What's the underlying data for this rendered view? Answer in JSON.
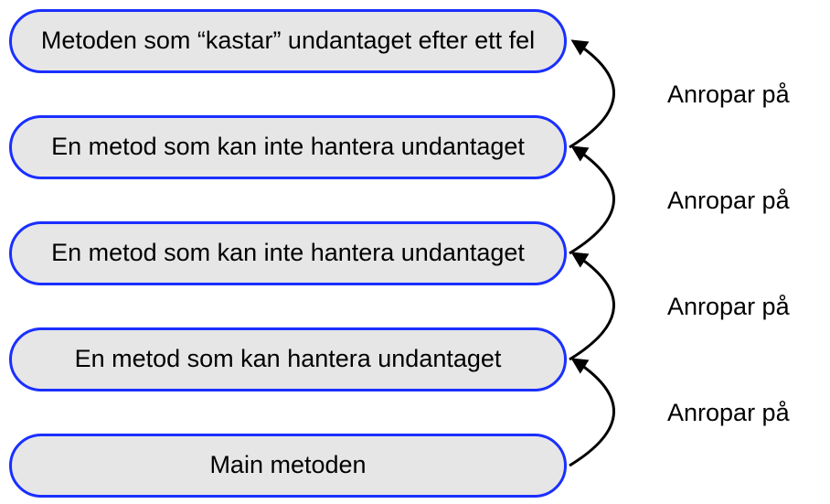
{
  "nodes": [
    {
      "label": "Metoden som “kastar” undantaget efter ett fel"
    },
    {
      "label": "En metod som kan inte hantera undantaget"
    },
    {
      "label": "En metod som kan inte hantera undantaget"
    },
    {
      "label": "En metod som kan hantera undantaget"
    },
    {
      "label": "Main metoden"
    }
  ],
  "arrows": [
    {
      "label": "Anropar på"
    },
    {
      "label": "Anropar på"
    },
    {
      "label": "Anropar på"
    },
    {
      "label": "Anropar på"
    }
  ],
  "colors": {
    "node_border": "#1a2fff",
    "node_fill": "#e6e6e6",
    "arrow": "#000000"
  }
}
